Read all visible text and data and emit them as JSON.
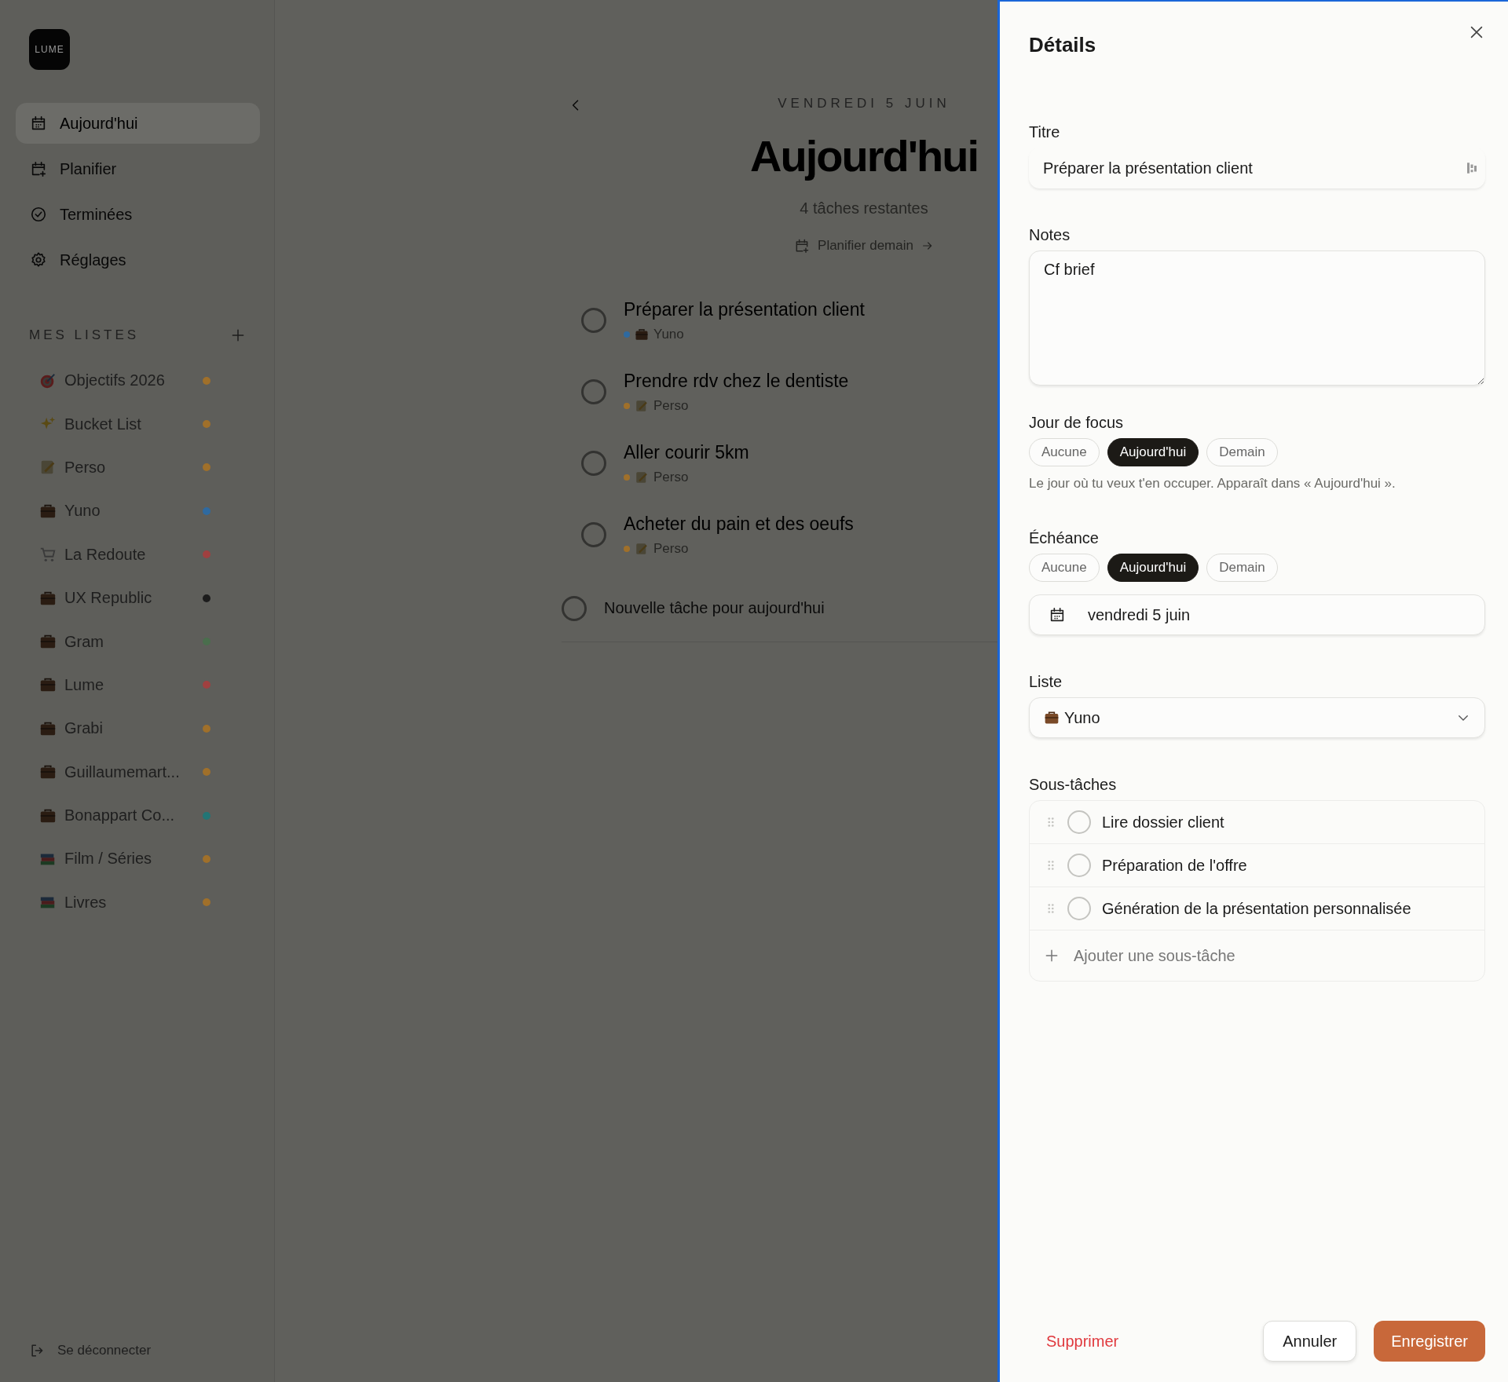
{
  "sidebar": {
    "logo": "LUME",
    "nav": [
      {
        "label": "Aujourd'hui",
        "kind": "calendar",
        "selected": true
      },
      {
        "label": "Planifier",
        "kind": "calendar-plus",
        "selected": false
      },
      {
        "label": "Terminées",
        "kind": "check-circle",
        "selected": false
      },
      {
        "label": "Réglages",
        "kind": "gear",
        "selected": false
      }
    ],
    "lists_heading": "MES LISTES",
    "lists": [
      {
        "name": "Objectifs 2026",
        "kind": "target",
        "color": "#a0702a"
      },
      {
        "name": "Bucket List",
        "kind": "sparkles",
        "color": "#a0702a"
      },
      {
        "name": "Perso",
        "kind": "notepad",
        "color": "#a0702a"
      },
      {
        "name": "Yuno",
        "kind": "briefcase",
        "color": "#2f6aa0"
      },
      {
        "name": "La Redoute",
        "kind": "cart",
        "color": "#a04040"
      },
      {
        "name": "UX Republic",
        "kind": "briefcase",
        "color": "#1c1c1c"
      },
      {
        "name": "Gram",
        "kind": "briefcase",
        "color": "#4a6e4d"
      },
      {
        "name": "Lume",
        "kind": "briefcase",
        "color": "#a04040"
      },
      {
        "name": "Grabi",
        "kind": "briefcase",
        "color": "#a0702a"
      },
      {
        "name": "Guillaumemart...",
        "kind": "briefcase",
        "color": "#a0702a"
      },
      {
        "name": "Bonappart Co...",
        "kind": "briefcase",
        "color": "#237575"
      },
      {
        "name": "Film / Séries",
        "kind": "books",
        "color": "#a0702a"
      },
      {
        "name": "Livres",
        "kind": "books",
        "color": "#a0702a"
      }
    ],
    "logout": "Se déconnecter"
  },
  "main": {
    "date": "VENDREDI 5 JUIN",
    "title": "Aujourd'hui",
    "remaining": "4 tâches restantes",
    "plan_link": "Planifier demain",
    "tasks": [
      {
        "title": "Préparer la présentation client",
        "checked": false,
        "list": "Yuno",
        "kind": "briefcase",
        "color": "#2f6aa0"
      },
      {
        "title": "Prendre rdv chez le dentiste",
        "checked": false,
        "list": "Perso",
        "kind": "notepad",
        "color": "#a0702a"
      },
      {
        "title": "Aller courir 5km",
        "checked": false,
        "list": "Perso",
        "kind": "notepad",
        "color": "#a0702a"
      },
      {
        "title": "Acheter du pain et des oeufs",
        "checked": false,
        "list": "Perso",
        "kind": "notepad",
        "color": "#a0702a"
      }
    ],
    "new_task_placeholder": "Nouvelle tâche pour aujourd'hui"
  },
  "details": {
    "heading": "Détails",
    "title_label": "Titre",
    "title_value": "Préparer la présentation client",
    "notes_label": "Notes",
    "notes_value": "Cf brief",
    "focus": {
      "label": "Jour de focus",
      "options": [
        {
          "label": "Aucune",
          "selected": false
        },
        {
          "label": "Aujourd'hui",
          "selected": true
        },
        {
          "label": "Demain",
          "selected": false
        }
      ],
      "hint": "Le jour où tu veux t'en occuper. Apparaît dans « Aujourd'hui »."
    },
    "due": {
      "label": "Échéance",
      "options": [
        {
          "label": "Aucune",
          "selected": false
        },
        {
          "label": "Aujourd'hui",
          "selected": true
        },
        {
          "label": "Demain",
          "selected": false
        }
      ],
      "date": "vendredi 5 juin"
    },
    "list": {
      "label": "Liste",
      "kind": "briefcase",
      "value": "Yuno"
    },
    "subtasks": {
      "label": "Sous-tâches",
      "items": [
        {
          "title": "Lire dossier client",
          "checked": false
        },
        {
          "title": "Préparation de l'offre",
          "checked": false
        },
        {
          "title": "Génération de la présentation personnalisée",
          "checked": false
        }
      ],
      "add": "Ajouter une sous-tâche"
    },
    "buttons": {
      "delete": "Supprimer",
      "cancel": "Annuler",
      "save": "Enregistrer"
    }
  }
}
